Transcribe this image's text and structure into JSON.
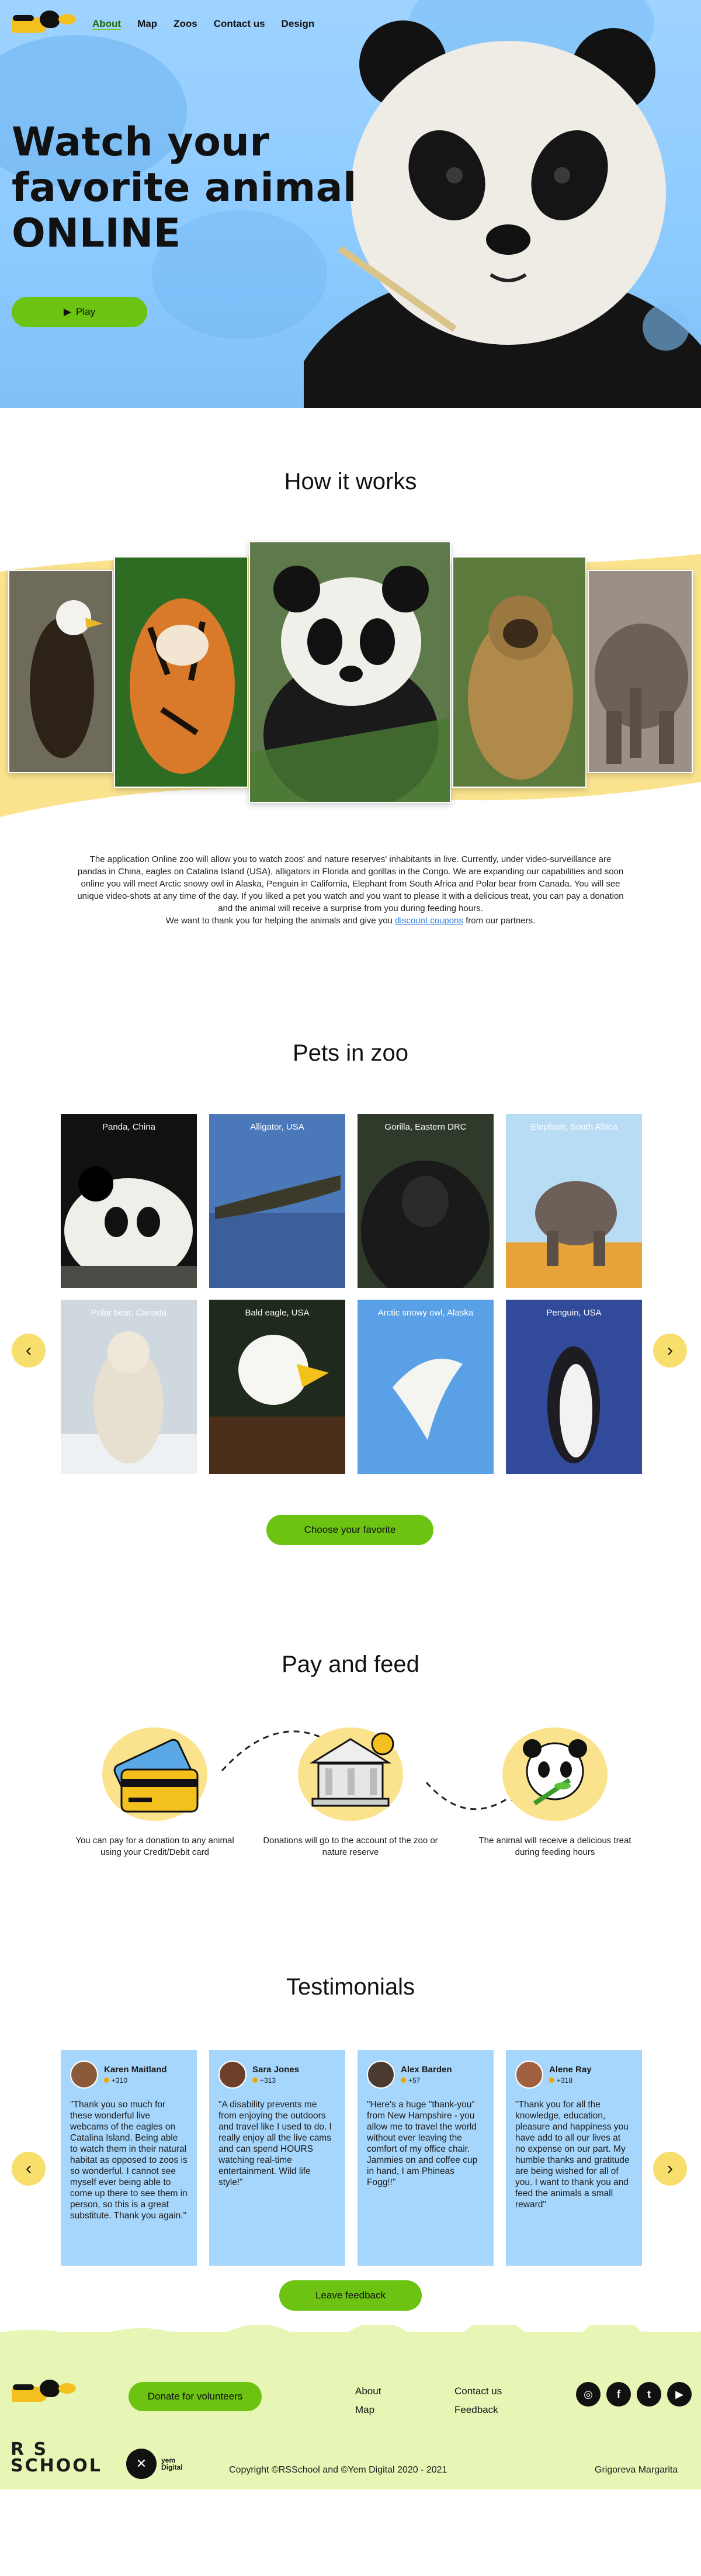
{
  "nav": {
    "items": [
      "About",
      "Map",
      "Zoos",
      "Contact us",
      "Design"
    ]
  },
  "hero": {
    "title_line1": "Watch your",
    "title_line2": "favorite animal",
    "title_line3": "ONLINE",
    "play_icon": "play-icon",
    "play_label": "Play"
  },
  "how": {
    "title": "How it works",
    "text_main": "The application Online zoo will allow you to watch zoos' and nature reserves' inhabitants in live. Currently, under video-surveillance are pandas in China, eagles on Catalina Island (USA), alligators in Florida and gorillas in the Congo. We are expanding our capabilities and soon online you will meet Arctic snowy owl in Alaska, Penguin in California, Elephant from South Africa and Polar bear from Canada. You will see unique video-shots at any time of the day. If you liked a pet you watch and you want to please it with a delicious treat, you can pay a donation and the animal will receive a surprise from you during feeding hours.",
    "text_thanks": "We want to thank you for helping the animals and give you",
    "coupon_link": "discount coupons",
    "text_end": "from our partners."
  },
  "pets": {
    "title": "Pets in zoo",
    "cards": [
      {
        "caption": "Panda, China"
      },
      {
        "caption": "Alligator, USA"
      },
      {
        "caption": "Gorilla, Eastern DRC"
      },
      {
        "caption": "Elephant, South Africa"
      },
      {
        "caption": "Polar bear, Canada"
      },
      {
        "caption": "Bald eagle, USA"
      },
      {
        "caption": "Arctic snowy owl, Alaska"
      },
      {
        "caption": "Penguin, USA"
      }
    ],
    "prev_icon": "‹",
    "next_icon": "›",
    "choose_label": "Choose your favorite"
  },
  "pay": {
    "title": "Pay and feed",
    "steps": [
      {
        "text": "You can pay for a donation to any animal using your Credit/Debit card"
      },
      {
        "text": "Donations will go to the account of the zoo or nature reserve"
      },
      {
        "text": "The animal will receive a delicious treat during feeding hours"
      }
    ]
  },
  "testimonials": {
    "title": "Testimonials",
    "items": [
      {
        "name": "Karen Maitland",
        "score": "+310",
        "quote": "\"Thank you so much for these wonderful live webcams of the eagles on Catalina Island. Being able to watch them in their natural habitat as opposed to zoos is so wonderful. I cannot see myself ever being able to come up there to see them in person, so this is a great substitute. Thank you again.\""
      },
      {
        "name": "Sara Jones",
        "score": "+313",
        "quote": "\"A disability prevents me from enjoying the outdoors and travel like I used to do. I really enjoy all the live cams and can spend HOURS watching real-time entertainment. Wild life style!\""
      },
      {
        "name": "Alex Barden",
        "score": "+57",
        "quote": "\"Here's a huge \"thank-you\" from New Hampshire - you allow me to travel the world without ever leaving the comfort of my office chair. Jammies on and coffee cup in hand, I am Phineas Fogg!!\""
      },
      {
        "name": "Alene Ray",
        "score": "+318",
        "quote": "\"Thank you for all the knowledge, education, pleasure and happiness you have add to all our lives at no expense on our part. My humble thanks and gratitude are being wished for all of you. I want to thank you and feed the animals a small reward\""
      }
    ],
    "leave_label": "Leave feedback"
  },
  "footer": {
    "donate_label": "Donate for volunteers",
    "links_col1": [
      "About",
      "Map"
    ],
    "links_col2": [
      "Contact us",
      "Feedback"
    ],
    "social": [
      "instagram-icon",
      "facebook-icon",
      "twitter-icon",
      "youtube-icon"
    ],
    "rs_line1": "R S",
    "rs_line2": "SCHOOL",
    "yem_line1": "yem",
    "yem_line2": "Digital",
    "copyright": "Copyright ©RSSchool and ©Yem Digital 2020 - 2021",
    "author": "Grigoreva Margarita"
  },
  "colors": {
    "accent_green": "#6cc312",
    "arrow_yellow": "#f8de6c",
    "card_blue": "#a6d6fb",
    "footer_bg": "#e7f5b5"
  }
}
